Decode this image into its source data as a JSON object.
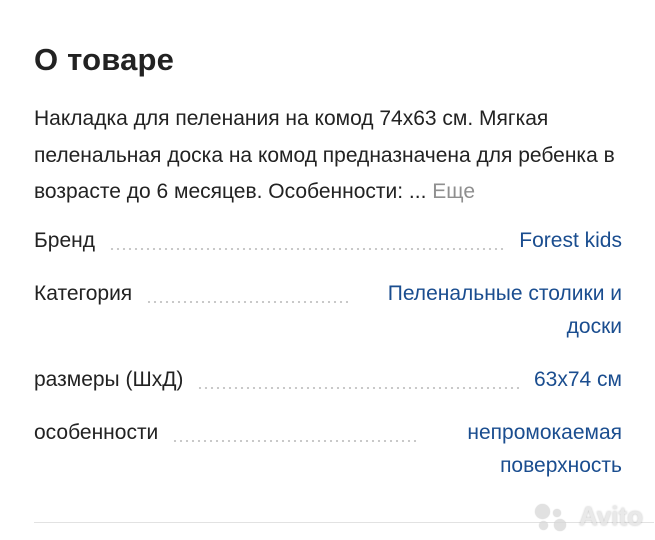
{
  "section": {
    "title": "О товаре",
    "description": "Накладка для пеленания на комод 74х63 см. Мягкая пеленальная доска на комод предназначена для ребенка в возрасте до 6 месяцев. Особенности: ...",
    "more_label": "Еще"
  },
  "properties": [
    {
      "label": "Бренд",
      "value": "Forest kids"
    },
    {
      "label": "Категория",
      "value": "Пеленальные столики и доски"
    },
    {
      "label": "размеры (ШхД)",
      "value": "63х74 см"
    },
    {
      "label": "особенности",
      "value": "непромокаемая поверхность"
    }
  ],
  "watermark": {
    "text": "Avito"
  },
  "colors": {
    "link": "#1a4d8f",
    "muted": "#8f8f8f",
    "text": "#222222"
  }
}
